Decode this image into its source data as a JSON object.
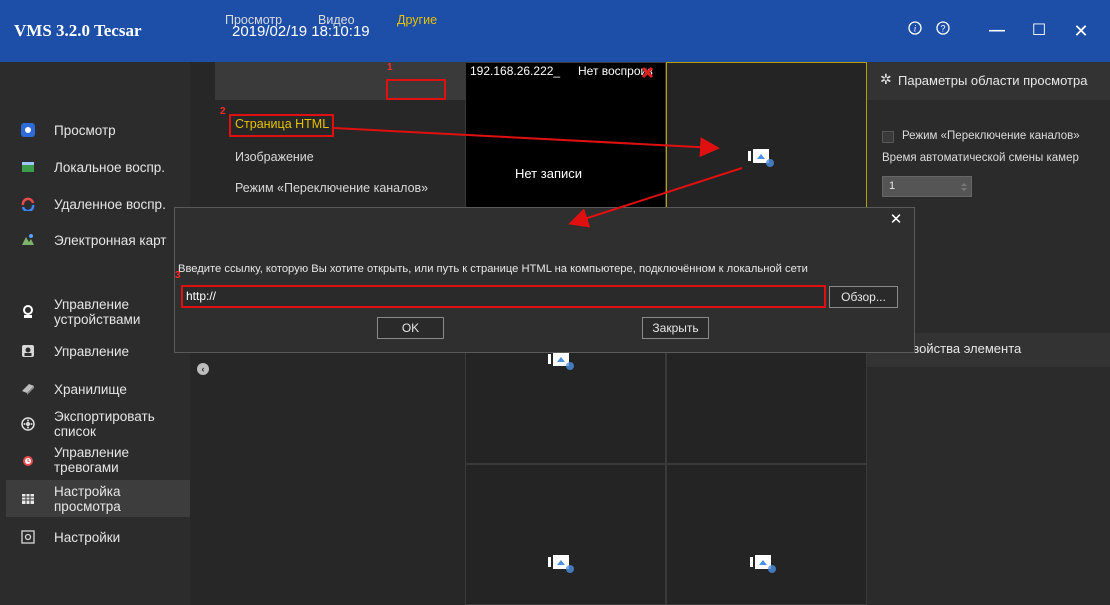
{
  "app": {
    "title": "VMS 3.2.0 Tecsar",
    "datetime": "2019/02/19 18:10:19"
  },
  "window_controls": {
    "info": "ⓘ",
    "help": "?",
    "minimize": "—",
    "maximize": "☐",
    "close": "✕"
  },
  "sidebar": {
    "items": [
      {
        "label": "Просмотр",
        "icon": "preview-icon"
      },
      {
        "label": "Локальное воспр.",
        "icon": "local-playback-icon"
      },
      {
        "label": "Удаленное воспр.",
        "icon": "remote-playback-icon"
      },
      {
        "label": "Электронная карт",
        "icon": "emap-icon"
      },
      {
        "label": "Управление устройствами",
        "icon": "device-management-icon"
      },
      {
        "label": "Управление",
        "icon": "management-icon"
      },
      {
        "label": "Хранилище",
        "icon": "storage-icon"
      },
      {
        "label": "Экспортировать список",
        "icon": "export-list-icon"
      },
      {
        "label": "Управление тревогами",
        "icon": "alarm-icon"
      },
      {
        "label": "Настройка просмотра",
        "icon": "view-settings-icon"
      },
      {
        "label": "Настройки",
        "icon": "settings-icon"
      }
    ]
  },
  "tabs": {
    "preview": "Просмотр",
    "video": "Видео",
    "other": "Другие"
  },
  "menu": {
    "html_page": "Страница HTML",
    "image": "Изображение",
    "channel_switch_mode": "Режим «Переключение каналов»"
  },
  "grid": {
    "cell1_ip": "192.168.26.222_",
    "cell1_status": "Нет воспроиз",
    "cell1_center": "Нет записи"
  },
  "right_panel": {
    "header": "Параметры области просмотра",
    "channel_switch_label": "Режим «Переключение каналов»",
    "auto_switch_time_label": "Время автоматической смены камер",
    "auto_switch_value": "1",
    "element_props": "Свойства элемента"
  },
  "dialog": {
    "prompt": "Введите ссылку, которую Вы хотите открыть, или путь к странице HTML на компьютере, подключённом к локальной сети",
    "url_value": "http://",
    "browse_button": "Обзор...",
    "ok_button": "OK",
    "close_button": "Закрыть",
    "close_icon": "✕"
  },
  "annotations": {
    "n1": "1",
    "n2": "2",
    "n3": "3"
  },
  "colors": {
    "titlebar": "#1d4fa8",
    "accent_yellow": "#e8c100",
    "annotation_red": "#e01010",
    "dark_bg": "#2b2b2b"
  }
}
